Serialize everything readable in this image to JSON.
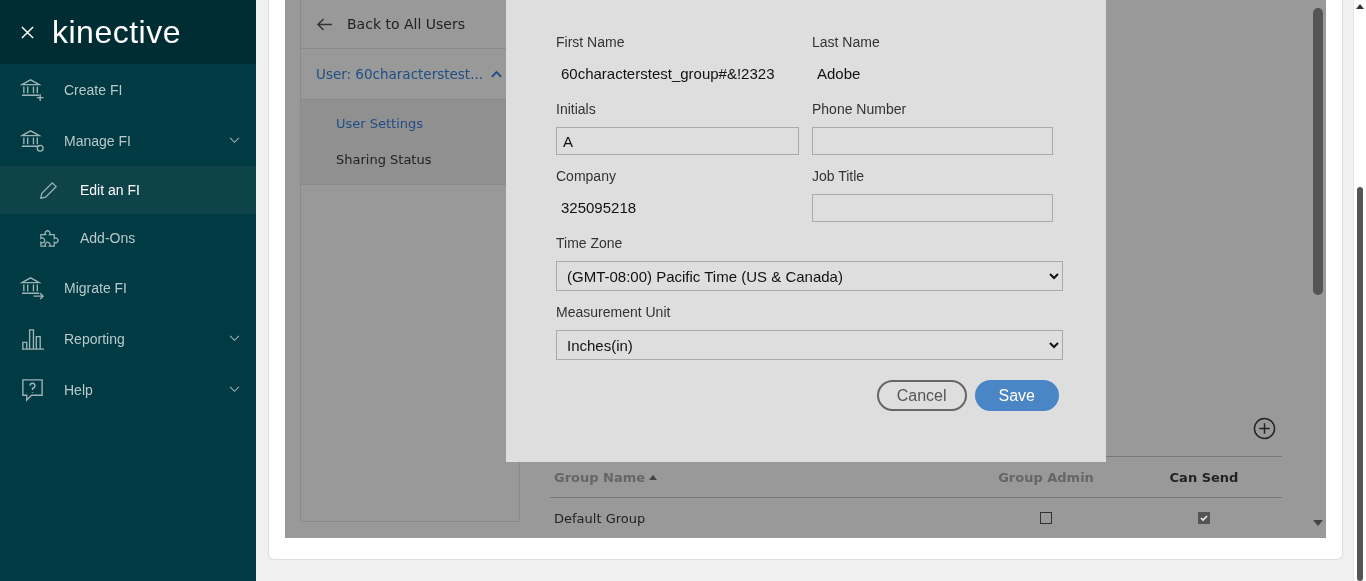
{
  "sidebar": {
    "logo": "kinective",
    "items": [
      {
        "label": "Create FI",
        "expandable": false,
        "selected": false
      },
      {
        "label": "Manage FI",
        "expandable": true,
        "selected": false,
        "children": [
          {
            "label": "Edit an FI",
            "selected": true
          },
          {
            "label": "Add-Ons",
            "selected": false
          }
        ]
      },
      {
        "label": "Migrate FI",
        "expandable": false,
        "selected": false
      },
      {
        "label": "Reporting",
        "expandable": true,
        "selected": false
      },
      {
        "label": "Help",
        "expandable": true,
        "selected": false
      }
    ]
  },
  "user_panel": {
    "back_link": "Back to All Users",
    "user": {
      "label": "User: 60characterstest...",
      "expanded": true
    },
    "items": [
      {
        "label": "User Settings",
        "selected": true
      },
      {
        "label": "Sharing Status",
        "selected": false
      }
    ]
  },
  "modal": {
    "fields": [
      {
        "label": "First Name",
        "kind": "text",
        "value": "60characterstest_group#&!2323"
      },
      {
        "label": "Last Name",
        "kind": "text",
        "value": "Adobe"
      },
      {
        "label": "Initials",
        "kind": "input",
        "value": "A"
      },
      {
        "label": "Phone Number",
        "kind": "input"
      },
      {
        "label": "Company",
        "kind": "text",
        "value": "325095218"
      },
      {
        "label": "Job Title",
        "kind": "input"
      },
      {
        "label": "Time Zone",
        "kind": "select",
        "value": "(GMT-08:00) Pacific Time (US & Canada)"
      },
      {
        "label": "Measurement Unit",
        "kind": "select",
        "value": "Inches(in)"
      }
    ],
    "buttons": [
      {
        "label": "Cancel",
        "kind": "secondary"
      },
      {
        "label": "Save",
        "kind": "primary"
      }
    ]
  },
  "group_table": {
    "columns": [
      {
        "label": "Group Name",
        "sorted": true
      },
      {
        "label": "Group Admin",
        "sorted": false
      },
      {
        "label": "Can Send",
        "sorted": false
      }
    ],
    "rows": [
      {
        "name": "Default Group",
        "group_admin": false,
        "can_send": true
      }
    ]
  }
}
